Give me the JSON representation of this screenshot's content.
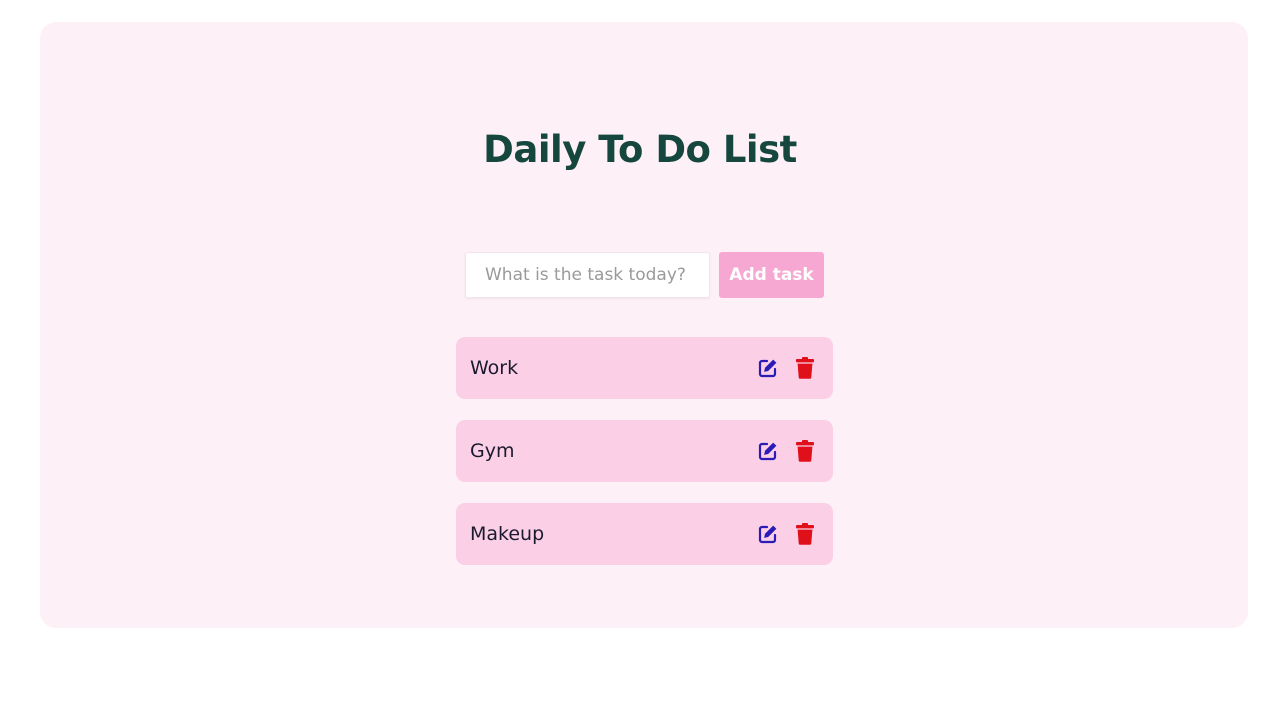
{
  "header": {
    "title": "Daily To Do List"
  },
  "form": {
    "placeholder": "What is the task today?",
    "value": "",
    "add_label": "Add task"
  },
  "tasks": [
    {
      "label": "Work"
    },
    {
      "label": "Gym"
    },
    {
      "label": "Makeup"
    }
  ],
  "icons": {
    "edit": "edit-icon",
    "delete": "trash-icon"
  },
  "colors": {
    "background": "#fdf0f6",
    "title": "#15473f",
    "button": "#f7a8d2",
    "task_bg": "#fbcfe6",
    "edit_icon": "#2b1cb8",
    "delete_icon": "#e0101b"
  }
}
